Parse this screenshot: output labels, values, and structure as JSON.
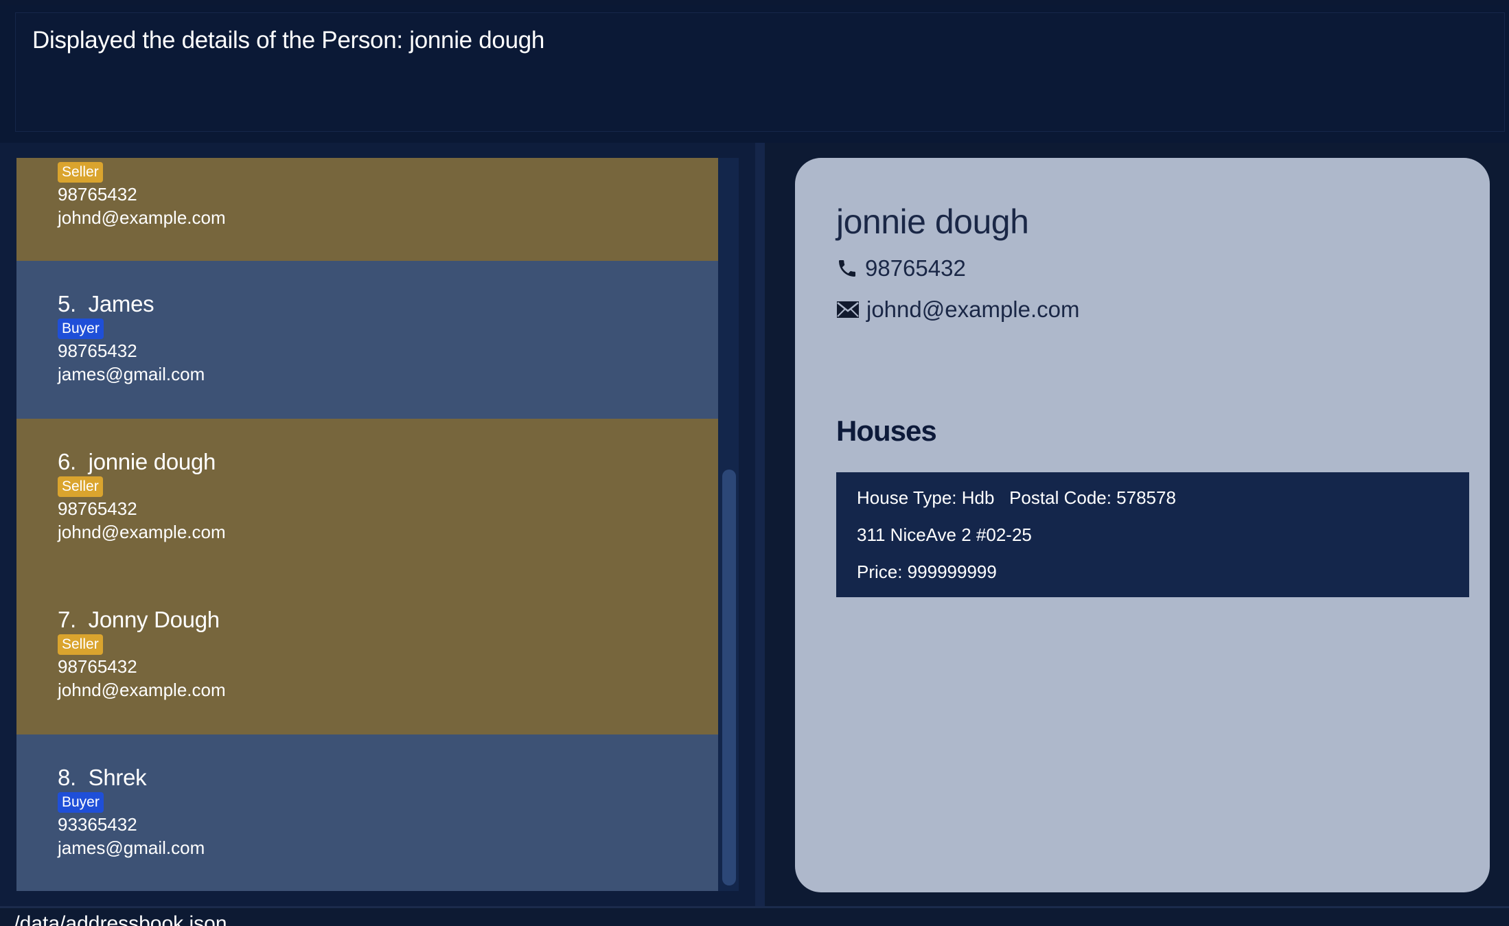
{
  "result_display": {
    "message": "Displayed the details of the Person: jonnie dough"
  },
  "person_list": {
    "cards": [
      {
        "name": "",
        "tag": "Seller",
        "phone": "98765432",
        "email": "johnd@example.com"
      },
      {
        "name": "5.  James",
        "tag": "Buyer",
        "phone": "98765432",
        "email": "james@gmail.com"
      },
      {
        "name": "6.  jonnie dough",
        "tag": "Seller",
        "phone": "98765432",
        "email": "johnd@example.com"
      },
      {
        "name": "7.  Jonny Dough",
        "tag": "Seller",
        "phone": "98765432",
        "email": "johnd@example.com"
      },
      {
        "name": "8.  Shrek",
        "tag": "Buyer",
        "phone": "93365432",
        "email": "james@gmail.com"
      }
    ]
  },
  "person_detail": {
    "name": "jonnie dough",
    "phone": "98765432",
    "email": "johnd@example.com",
    "phone_icon": "phone-icon",
    "email_icon": "envelope-icon",
    "houses_title": "Houses",
    "houses": [
      {
        "type_line": "House Type: Hdb   Postal Code: 578578",
        "address": "311 NiceAve 2 #02-25",
        "price": "Price: 999999999"
      }
    ]
  },
  "status_bar": {
    "path": "./data/addressbook.json"
  },
  "colors": {
    "seller_card": "#77663d",
    "buyer_card": "#3d5275",
    "seller_tag": "#daa42e",
    "buyer_tag": "#1f4fd8",
    "detail_card": "#aeb8cb",
    "background": "#0d1a33"
  }
}
